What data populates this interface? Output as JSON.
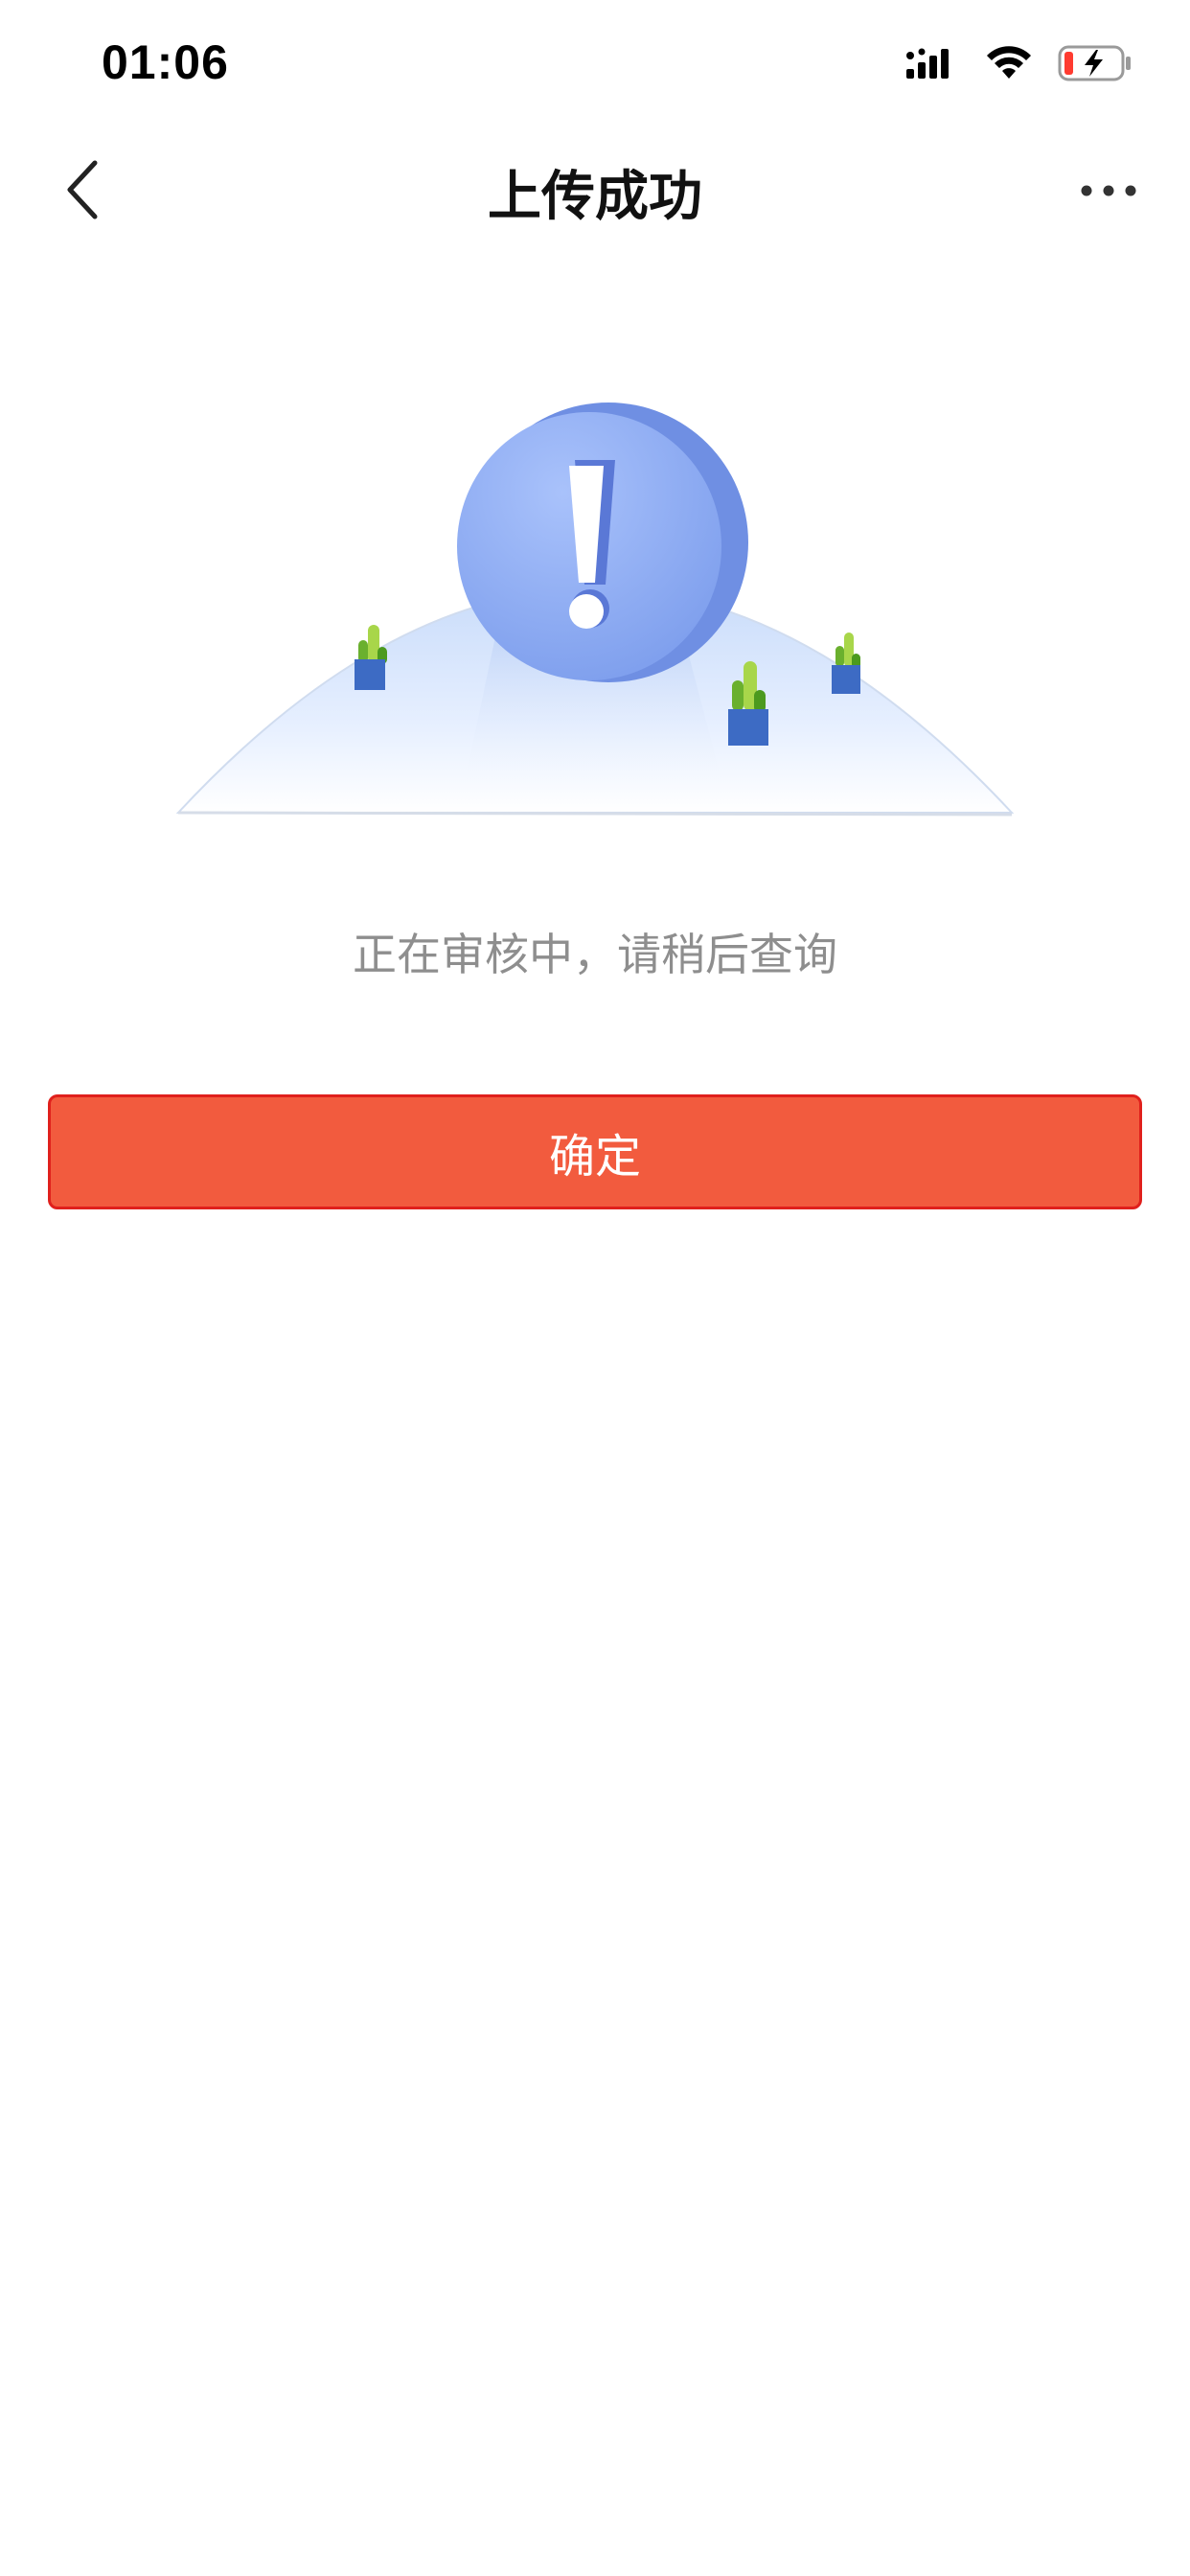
{
  "status_bar": {
    "time": "01:06",
    "icons": [
      "cellular-signal-icon",
      "wifi-icon",
      "battery-charging-icon"
    ],
    "battery_low_color": "#ff3b30"
  },
  "nav": {
    "title": "上传成功",
    "back_icon": "chevron-left-icon",
    "more_icon": "more-dots-icon"
  },
  "illustration": {
    "icon": "exclamation-circle-icon",
    "decor": "cactus-pots"
  },
  "message": "正在审核中，请稍后查询",
  "confirm_button": {
    "label": "确定",
    "bg_color": "#f25b3e",
    "border_color": "#e0201c"
  }
}
